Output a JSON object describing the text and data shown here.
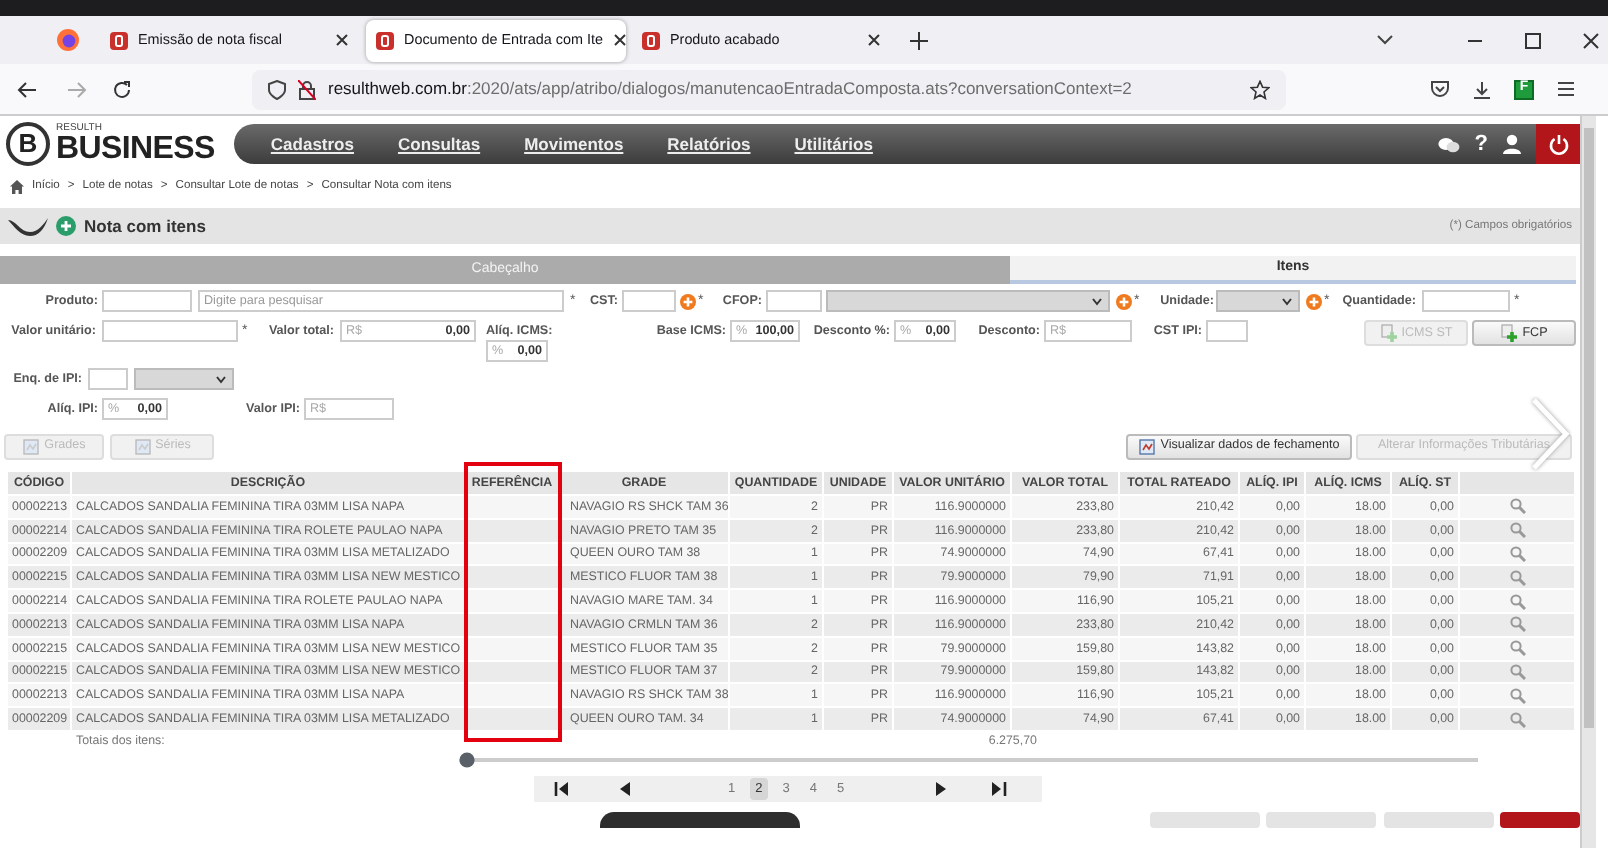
{
  "browser": {
    "tabs": [
      {
        "title": "Emissão de nota fiscal",
        "selected": false
      },
      {
        "title": "Documento de Entrada com Ite",
        "selected": true
      },
      {
        "title": "Produto acabado",
        "selected": false
      }
    ],
    "url": {
      "host": "resulthweb.com.br",
      "path": ":2020/ats/app/atribo/dialogos/manutencaoEntradaComposta.ats?conversationContext=2"
    },
    "extension_label": "F"
  },
  "app": {
    "logo_letter": "B",
    "logo_top": "RESULTH",
    "logo_name": "BUSINESS",
    "menu": [
      "Cadastros",
      "Consultas",
      "Movimentos",
      "Relatórios",
      "Utilitários"
    ],
    "help_label": "?"
  },
  "breadcrumb": [
    {
      "label": "Início"
    },
    {
      "separator": ">",
      "label": "Lote de notas"
    },
    {
      "separator": ">",
      "label": "Consultar Lote de notas"
    },
    {
      "separator": ">",
      "label": "Consultar Nota com itens"
    }
  ],
  "page": {
    "title": "Nota com itens",
    "required_note": "(*) Campos obrigatórios"
  },
  "section_tabs": [
    {
      "label": "Cabeçalho",
      "selected": false
    },
    {
      "label": "Itens",
      "selected": true
    }
  ],
  "form": {
    "rows": [
      {
        "items": [
          {
            "kind": "label",
            "text": "Produto:"
          },
          {
            "kind": "input"
          },
          {
            "kind": "input",
            "placeholder": "Digite para pesquisar"
          },
          {
            "kind": "required",
            "text": "*"
          },
          {
            "kind": "label",
            "text": "CST:"
          },
          {
            "kind": "input"
          },
          {
            "kind": "add"
          },
          {
            "kind": "required",
            "text": "*"
          },
          {
            "kind": "label",
            "text": "CFOP:"
          },
          {
            "kind": "input"
          },
          {
            "kind": "select"
          },
          {
            "kind": "add"
          },
          {
            "kind": "required",
            "text": "*"
          },
          {
            "kind": "label",
            "text": "Unidade:"
          },
          {
            "kind": "select"
          },
          {
            "kind": "add"
          },
          {
            "kind": "required",
            "text": "*"
          },
          {
            "kind": "label",
            "text": "Quantidade:"
          },
          {
            "kind": "input"
          },
          {
            "kind": "required",
            "text": "*"
          }
        ]
      },
      {
        "items": [
          {
            "kind": "label",
            "text": "Valor unitário:"
          },
          {
            "kind": "input"
          },
          {
            "kind": "required",
            "text": "*"
          },
          {
            "kind": "label",
            "text": "Valor total:"
          },
          {
            "kind": "input",
            "prefix": "R$",
            "value": "0,00"
          },
          {
            "kind": "stacked",
            "text": "Alíq. ICMS:",
            "prefix": "%",
            "value": "0,00"
          },
          {
            "kind": "label",
            "text": "Base ICMS:"
          },
          {
            "kind": "input",
            "prefix": "%",
            "value": "100,00"
          },
          {
            "kind": "label",
            "text": "Desconto %:"
          },
          {
            "kind": "input",
            "prefix": "%",
            "value": "0,00"
          },
          {
            "kind": "label",
            "text": "Desconto:"
          },
          {
            "kind": "input",
            "prefix": "R$"
          },
          {
            "kind": "label",
            "text": "CST IPI:"
          },
          {
            "kind": "input"
          },
          {
            "kind": "button",
            "label": "ICMS ST",
            "disabled": true
          },
          {
            "kind": "button",
            "label": "FCP",
            "disabled": false
          }
        ]
      },
      {
        "items": [
          {
            "kind": "label",
            "text": "Enq. de IPI:"
          },
          {
            "kind": "input"
          },
          {
            "kind": "select"
          }
        ]
      },
      {
        "items": [
          {
            "kind": "label",
            "text": "Alíq. IPI:"
          },
          {
            "kind": "input",
            "prefix": "%",
            "value": "0,00"
          },
          {
            "kind": "label",
            "text": "Valor IPI:"
          },
          {
            "kind": "input",
            "prefix": "R$"
          }
        ]
      }
    ]
  },
  "actions": [
    {
      "label": "Grades",
      "disabled": true,
      "has_icon": true
    },
    {
      "label": "Séries",
      "disabled": true,
      "has_icon": true
    },
    {
      "label": "Visualizar dados de fechamento",
      "disabled": false,
      "has_icon": true
    },
    {
      "label": "Alterar Informações Tributárias",
      "disabled": true,
      "has_icon": false
    }
  ],
  "table": {
    "columns": [
      {
        "label": "CÓDIGO",
        "kind": "text"
      },
      {
        "label": "DESCRIÇÃO",
        "kind": "text"
      },
      {
        "label": "REFERÊNCIA",
        "kind": "text"
      },
      {
        "label": "GRADE",
        "kind": "text"
      },
      {
        "label": "QUANTIDADE",
        "kind": "number"
      },
      {
        "label": "UNIDADE",
        "kind": "number"
      },
      {
        "label": "VALOR UNITÁRIO",
        "kind": "number"
      },
      {
        "label": "VALOR TOTAL",
        "kind": "number"
      },
      {
        "label": "TOTAL RATEADO",
        "kind": "number"
      },
      {
        "label": "ALÍQ. IPI",
        "kind": "number"
      },
      {
        "label": "ALÍQ. ICMS",
        "kind": "number"
      },
      {
        "label": "ALÍQ. ST",
        "kind": "number"
      },
      {
        "kind": "action"
      }
    ],
    "rows": [
      {
        "cells": [
          "00002213",
          "CALCADOS SANDALIA FEMININA TIRA 03MM LISA NAPA",
          "",
          "NAVAGIO RS SHCK TAM 36",
          "2",
          "PR",
          "116.9000000",
          "233,80",
          "210,42",
          "0,00",
          "18.00",
          "0,00"
        ]
      },
      {
        "cells": [
          "00002214",
          "CALCADOS SANDALIA FEMININA TIRA ROLETE PAULAO NAPA",
          "",
          "NAVAGIO PRETO TAM 35",
          "2",
          "PR",
          "116.9000000",
          "233,80",
          "210,42",
          "0,00",
          "18.00",
          "0,00"
        ]
      },
      {
        "cells": [
          "00002209",
          "CALCADOS SANDALIA FEMININA TIRA 03MM LISA METALIZADO",
          "",
          "QUEEN OURO TAM 38",
          "1",
          "PR",
          "74.9000000",
          "74,90",
          "67,41",
          "0,00",
          "18.00",
          "0,00"
        ]
      },
      {
        "cells": [
          "00002215",
          "CALCADOS SANDALIA FEMININA TIRA 03MM LISA NEW MESTICO",
          "",
          "MESTICO FLUOR TAM 38",
          "1",
          "PR",
          "79.9000000",
          "79,90",
          "71,91",
          "0,00",
          "18.00",
          "0,00"
        ]
      },
      {
        "cells": [
          "00002214",
          "CALCADOS SANDALIA FEMININA TIRA ROLETE PAULAO NAPA",
          "",
          "NAVAGIO MARE TAM. 34",
          "1",
          "PR",
          "116.9000000",
          "116,90",
          "105,21",
          "0,00",
          "18.00",
          "0,00"
        ]
      },
      {
        "cells": [
          "00002213",
          "CALCADOS SANDALIA FEMININA TIRA 03MM LISA NAPA",
          "",
          "NAVAGIO CRMLN TAM 36",
          "2",
          "PR",
          "116.9000000",
          "233,80",
          "210,42",
          "0,00",
          "18.00",
          "0,00"
        ]
      },
      {
        "cells": [
          "00002215",
          "CALCADOS SANDALIA FEMININA TIRA 03MM LISA NEW MESTICO",
          "",
          "MESTICO FLUOR TAM 35",
          "2",
          "PR",
          "79.9000000",
          "159,80",
          "143,82",
          "0,00",
          "18.00",
          "0,00"
        ]
      },
      {
        "cells": [
          "00002215",
          "CALCADOS SANDALIA FEMININA TIRA 03MM LISA NEW MESTICO",
          "",
          "MESTICO FLUOR TAM 37",
          "2",
          "PR",
          "79.9000000",
          "159,80",
          "143,82",
          "0,00",
          "18.00",
          "0,00"
        ]
      },
      {
        "cells": [
          "00002213",
          "CALCADOS SANDALIA FEMININA TIRA 03MM LISA NAPA",
          "",
          "NAVAGIO RS SHCK TAM 38",
          "1",
          "PR",
          "116.9000000",
          "116,90",
          "105,21",
          "0,00",
          "18.00",
          "0,00"
        ]
      },
      {
        "cells": [
          "00002209",
          "CALCADOS SANDALIA FEMININA TIRA 03MM LISA METALIZADO",
          "",
          "QUEEN OURO TAM. 34",
          "1",
          "PR",
          "74.9000000",
          "74,90",
          "67,41",
          "0,00",
          "18.00",
          "0,00"
        ]
      }
    ],
    "totals": {
      "label": "Totais dos itens:",
      "value": "6.275,70"
    }
  },
  "pager": {
    "pages": [
      {
        "label": "1",
        "selected": false
      },
      {
        "label": "2",
        "selected": true
      },
      {
        "label": "3",
        "selected": false
      },
      {
        "label": "4",
        "selected": false
      },
      {
        "label": "5",
        "selected": false
      }
    ]
  }
}
